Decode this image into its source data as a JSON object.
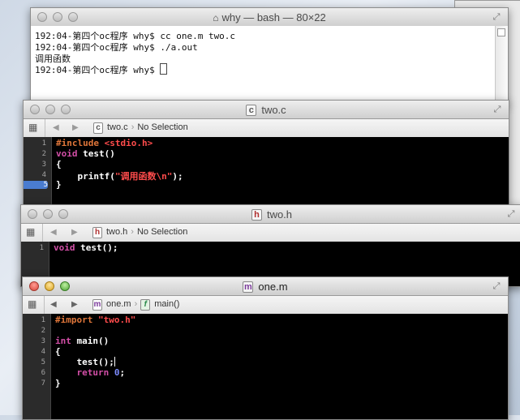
{
  "terminal": {
    "title": "why — bash — 80×22",
    "lines": [
      "192:04-第四个oc程序 why$ cc one.m two.c",
      "192:04-第四个oc程序 why$ ./a.out",
      "调用函数",
      "192:04-第四个oc程序 why$ "
    ]
  },
  "two_c": {
    "title": "two.c",
    "file_icon": "c",
    "crumb_file": "two.c",
    "crumb_selection": "No Selection",
    "line_numbers": [
      "1",
      "2",
      "3",
      "4",
      "5"
    ],
    "current_line": "5"
  },
  "two_h": {
    "title": "two.h",
    "file_icon": "h",
    "crumb_file": "two.h",
    "crumb_selection": "No Selection",
    "line_numbers": [
      "1"
    ]
  },
  "one_m": {
    "title": "one.m",
    "file_icon": "m",
    "crumb_file": "one.m",
    "crumb_func_icon": "f",
    "crumb_function": "main()",
    "line_numbers": [
      "1",
      "2",
      "3",
      "4",
      "5",
      "6",
      "7"
    ]
  },
  "code": {
    "two_c": {
      "l1_pp": "#include ",
      "l1_str": "<stdio.h>",
      "l2_kw": "void",
      "l2_rest": " test()",
      "l3": "{",
      "l4_pre": "    printf(",
      "l4_str": "\"调用函数\\n\"",
      "l4_post": ");",
      "l5": "}"
    },
    "two_h": {
      "l1_kw": "void",
      "l1_rest": " test();"
    },
    "one_m": {
      "l1_pp": "#import ",
      "l1_str": "\"two.h\"",
      "l3_kw": "int",
      "l3_rest": " main()",
      "l4": "{",
      "l5": "    test();",
      "l6_pre": "    ",
      "l6_kw": "return",
      "l6_sp": " ",
      "l6_num": "0",
      "l6_post": ";",
      "l7": "}"
    }
  },
  "icons": [
    "grid-icon",
    "back-arrow-icon",
    "forward-arrow-icon",
    "file-icon",
    "function-icon",
    "resize-icon",
    "home-icon"
  ],
  "colors": {
    "keyword": "#d44fa8",
    "preprocessor": "#e0763a",
    "string": "#ff4c4c",
    "number": "#7d8cff",
    "current_line": "#4a7cd0"
  }
}
